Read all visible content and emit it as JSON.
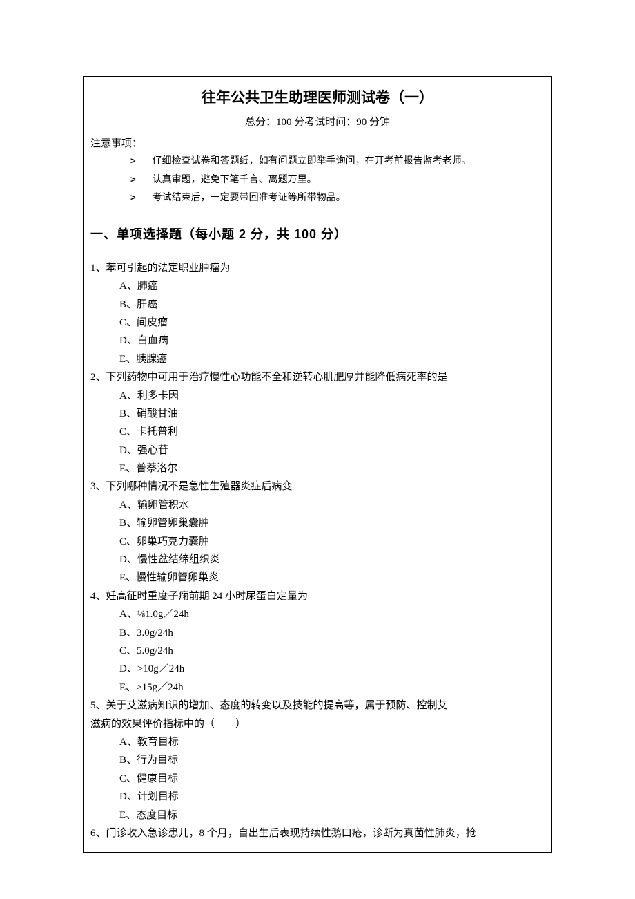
{
  "title": "往年公共卫生助理医师测试卷（一）",
  "subtitle": "总分：100 分考试时间：90 分钟",
  "noticeLabel": "注意事项：",
  "notices": [
    "仔细检查试卷和答题纸，如有问题立即举手询问，在开考前报告监考老师。",
    "认真审题，避免下笔千言、离题万里。",
    "考试结束后，一定要带回准考证等所带物品。"
  ],
  "sectionHeading": "一、单项选择题（每小题 2 分，共 100 分）",
  "questions": [
    {
      "stem": "1、苯可引起的法定职业肿瘤为",
      "options": [
        "A、肺癌",
        "B、肝癌",
        "C、间皮瘤",
        "D、白血病",
        "E、胰腺癌"
      ]
    },
    {
      "stem": "2、下列药物中可用于治疗慢性心功能不全和逆转心肌肥厚并能降低病死率的是",
      "options": [
        "A、利多卡因",
        "B、硝酸甘油",
        "C、卡托普利",
        "D、强心苷",
        "E、普萘洛尔"
      ]
    },
    {
      "stem": "3、下列哪种情况不是急性生殖器炎症后病变",
      "options": [
        "A、输卵管积水",
        "B、输卵管卵巢囊肿",
        "C、卵巢巧克力囊肿",
        "D、慢性盆结缔组织炎",
        "E、慢性输卵管卵巢炎"
      ]
    },
    {
      "stem": "4、妊高征时重度子痫前期 24 小时尿蛋白定量为",
      "options": [
        "A、⅛1.0g／24h",
        "B、3.0g/24h",
        "C、5.0g/24h",
        "D、>10g／24h",
        "E、>15g／24h"
      ]
    },
    {
      "stem": "5、关于艾滋病知识的增加、态度的转变以及技能的提高等，属于预防、控制艾",
      "stem2": "滋病的效果评价指标中的（　　）",
      "options": [
        "A、教育目标",
        "B、行为目标",
        "C、健康目标",
        "D、计划目标",
        "E、态度目标"
      ]
    },
    {
      "stem": "6、门诊收入急诊患儿，8 个月，自出生后表现持续性鹅口疮，诊断为真菌性肺炎，抢",
      "options": []
    }
  ]
}
